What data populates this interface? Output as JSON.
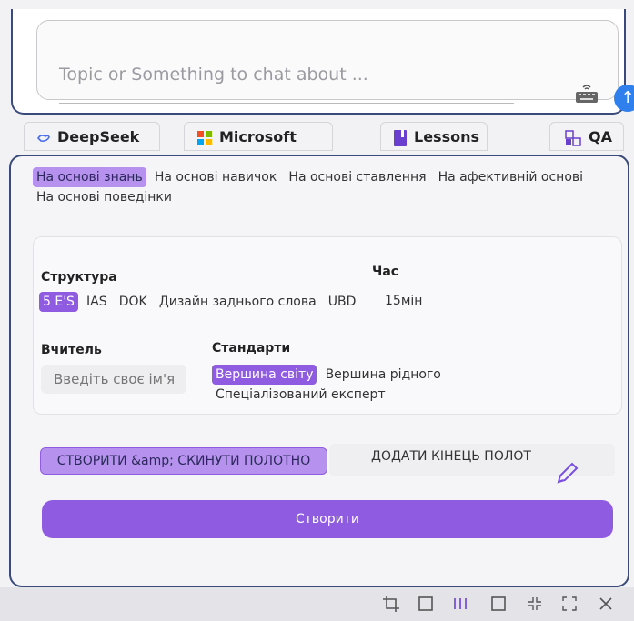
{
  "chat": {
    "placeholder": "Topic or Something to chat about ...",
    "send_icon": "arrow-up-icon",
    "keyboard_icon": "keyboard-icon"
  },
  "tabs": [
    {
      "label": "DeepSeek",
      "icon": "deepseek-icon"
    },
    {
      "label": "Microsoft Bing",
      "icon": "microsoft-logo-icon"
    },
    {
      "label": "Lessons",
      "icon": "book-icon"
    },
    {
      "label": "QA",
      "icon": "qa-icon"
    }
  ],
  "knowledge_types": {
    "items": [
      "На основі знань",
      "На основі навичок",
      "На основі ставлення",
      "На афективній основі",
      "На основі поведінки"
    ],
    "selected": "На основі знань"
  },
  "structure": {
    "label": "Структура",
    "items": [
      "5 E'S",
      "IAS",
      "DOK",
      "Дизайн заднього слова",
      "UBD"
    ],
    "selected": "5 E'S"
  },
  "time": {
    "label": "Час",
    "value": "15мін"
  },
  "teacher": {
    "label": "Вчитель",
    "placeholder": "Введіть своє ім'я"
  },
  "standards": {
    "label": "Стандарти",
    "items": [
      "Вершина світу",
      "Вершина рідного",
      "Спеціалізований експерт"
    ],
    "selected": "Вершина світу"
  },
  "actions": {
    "reset_label": "СТВОРИТИ &amp; СКИНУТИ ПОЛОТНО",
    "append_label": "ДОДАТИ КІНЕЦЬ ПОЛОТ",
    "create_label": "Створити"
  },
  "colors": {
    "accent": "#8f5be0",
    "accent_light": "#b692ee",
    "send": "#2f80ed",
    "frame_border": "#3a4a7a"
  }
}
